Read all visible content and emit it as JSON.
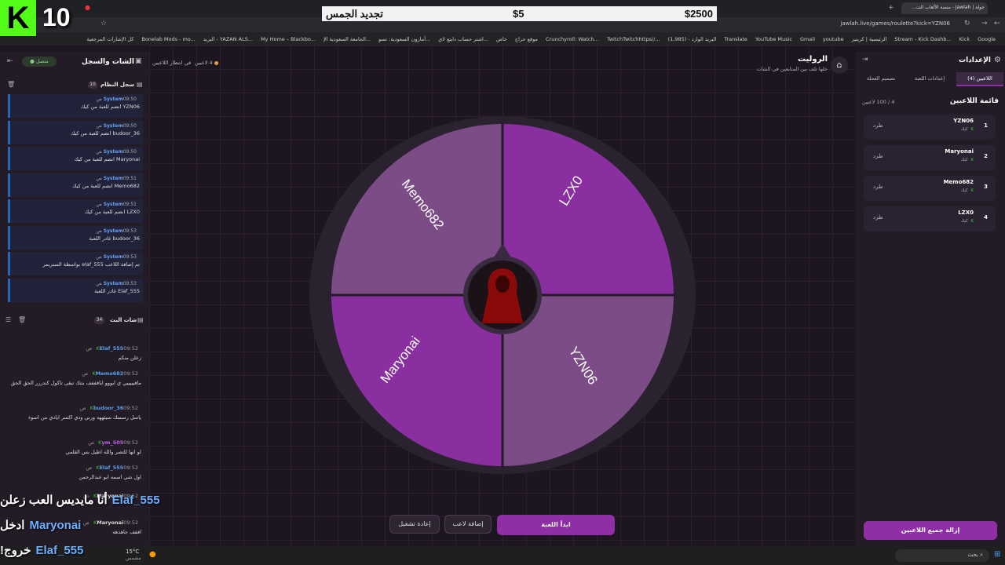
{
  "overlay": {
    "logo_letter": "K",
    "count": "10",
    "gems_label": "تجديد الجمس",
    "price": "$5",
    "amount": "$2500",
    "bottom_lines": [
      {
        "name": "Elaf_555",
        "text": "أنا مايديس العب زعلن"
      },
      {
        "name": "Maryonai",
        "text": "ادخل"
      },
      {
        "name": "Elaf_555",
        "text": "خروج!"
      }
    ]
  },
  "browser": {
    "url": "jawlah.live/games/roulette?kick=YZN06",
    "tab_title": "جولة | Jawlah - منصة الألعاب الت...",
    "bookmarks": [
      "Google",
      "Kick",
      "Stream - Kick Dashb...",
      "الرئيسية | كريتيز",
      "youtube",
      "Gmail",
      "YouTube Music",
      "Translate",
      "البريد الوارد - (1,985)",
      "TwitchTwitchhttps//...",
      "Crunchyroll: Watch...",
      "موقع حراج",
      "خاص",
      "اشتر حساب دايتع لاي...",
      "أمازون السعودية: تسو...",
      "الجامعة السعودية الإ...",
      "My Home – Blackbo...",
      "البريد - YAZAN ALS...",
      "Bonelab Mods - mo...",
      "كل الإشارات المرجعية"
    ]
  },
  "settings": {
    "title": "الإعدادات",
    "tabs": [
      "اللاعبين (4)",
      "إعدادات اللعبة",
      "تصميم العجلة"
    ],
    "list_title": "قائمة اللاعبين",
    "count": "4 / 100 لاعبين",
    "kick_label": "طرد",
    "players": [
      {
        "rank": "1",
        "name": "YZN06",
        "platform": "كيك"
      },
      {
        "rank": "2",
        "name": "Maryonai",
        "platform": "كيك"
      },
      {
        "rank": "3",
        "name": "Memo682",
        "platform": "كيك"
      },
      {
        "rank": "4",
        "name": "LZX0",
        "platform": "كيك"
      }
    ],
    "remove_all": "إزالة جميع اللاعبين"
  },
  "game": {
    "title": "الروليت",
    "subtitle": "خلها تلف بين المتابعين في الشات",
    "players_status": "4 لاعبين",
    "waiting_status": "في انتظار اللاعبين",
    "segments": [
      "LZX0",
      "YZN06",
      "Maryonai",
      "Memo682"
    ],
    "wheel_colors": {
      "light": "#7b4c86",
      "dark": "#8a2fa0"
    },
    "start_button": "ابدأ اللعبة",
    "add_player_button": "إضافة لاعب",
    "restart_button": "إعادة تشغيل"
  },
  "chat": {
    "title": "الشات والسجل",
    "connected": "متصل",
    "system_log_title": "سجل النظام",
    "system_count": "10",
    "system_msgs": [
      {
        "sender": "System",
        "time": "09:50 ص",
        "text": "YZN06 انضم للعبة من كيك"
      },
      {
        "sender": "System",
        "time": "09:50 ص",
        "text": "budoor_36 انضم للعبة من كيك"
      },
      {
        "sender": "System",
        "time": "09:50 ص",
        "text": "Maryonai انضم للعبة من كيك"
      },
      {
        "sender": "System",
        "time": "09:51 ص",
        "text": "Memo682 انضم للعبة من كيك"
      },
      {
        "sender": "System",
        "time": "09:51 ص",
        "text": "LZX0 انضم للعبة من كيك"
      },
      {
        "sender": "System",
        "time": "09:53 ص",
        "text": "budoor_36 غادر اللعبة"
      },
      {
        "sender": "System",
        "time": "09:53 ص",
        "text": "تم إضافة اللاعب elaf_555 بواسطة الستريمر"
      },
      {
        "sender": "System",
        "time": "09:53 ص",
        "text": "Elaf_555 غادر اللعبة"
      }
    ],
    "live_title": "شات البث",
    "live_count": "34",
    "live_msgs": [
      {
        "user": "Elaf_555",
        "time": "09:52 ص",
        "text": "زعلن منكم",
        "color": "#5aa0e8"
      },
      {
        "user": "Memo682",
        "time": "09:52 ص",
        "text": "مافيييييي ي ابووو ايافففف بنتك تبقى تاكول كندررر الحق الحق",
        "color": "#5aa0e8"
      },
      {
        "user": "budoor_36",
        "time": "09:52 ص",
        "text": "ياسل رسمتك سيئههه وربي ودي اكسر ايادي من اسوء",
        "color": "#5aa0e8"
      },
      {
        "user": "ym_505",
        "time": "09:52 ص",
        "text": "لو انها للتصر والله اطيل بس القلمي",
        "color": "#c060e0"
      },
      {
        "user": "Elaf_555",
        "time": "09:52 ص",
        "text": "اول شي اسمه ابو عبدالرحمن",
        "color": "#5aa0e8"
      },
      {
        "user": "Maryonai",
        "time": "09:52 ص",
        "text": "",
        "color": "#dddddd"
      },
      {
        "user": "Maryonai",
        "time": "09:52 ص",
        "text": "اففف جاهدهه",
        "color": "#dddddd"
      }
    ]
  },
  "taskbar": {
    "search": "بحث",
    "temp": "15°C",
    "weather": "مشمس"
  }
}
